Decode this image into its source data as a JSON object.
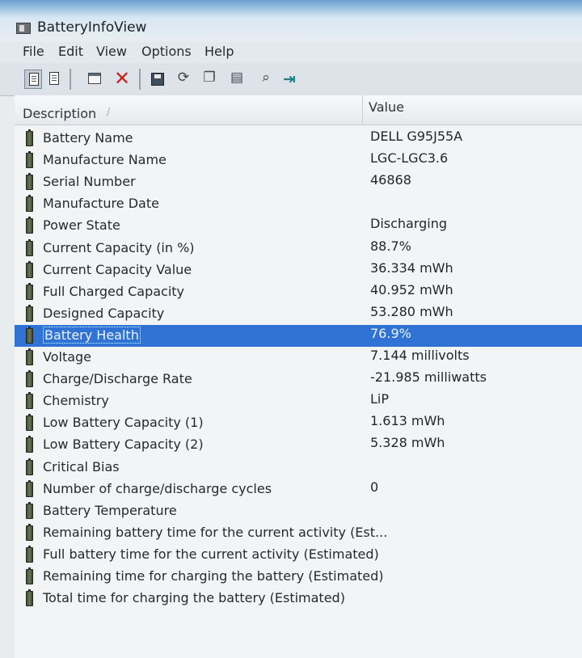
{
  "window": {
    "title": "BatteryInfoView",
    "icon": "battery-app-icon"
  },
  "menu": [
    "File",
    "Edit",
    "View",
    "Options",
    "Help"
  ],
  "toolbar": {
    "buttons": [
      "view-mode-icon",
      "report-icon",
      "open-icon",
      "delete-icon",
      "save-icon",
      "refresh-icon",
      "copy-icon",
      "properties-icon",
      "find-icon",
      "exit-icon"
    ]
  },
  "list": {
    "columns": {
      "description": "Description",
      "value": "Value"
    },
    "rows": [
      {
        "description": "Battery Name",
        "value": "DELL G95J55A"
      },
      {
        "description": "Manufacture Name",
        "value": "LGC-LGC3.6"
      },
      {
        "description": "Serial Number",
        "value": "46868"
      },
      {
        "description": "Manufacture Date",
        "value": ""
      },
      {
        "description": "Power State",
        "value": "Discharging"
      },
      {
        "description": "Current Capacity (in %)",
        "value": "88.7%"
      },
      {
        "description": "Current Capacity Value",
        "value": "36.334 mWh"
      },
      {
        "description": "Full Charged Capacity",
        "value": "40.952 mWh"
      },
      {
        "description": "Designed Capacity",
        "value": "53.280 mWh"
      },
      {
        "description": "Battery Health",
        "value": "76.9%",
        "selected": true
      },
      {
        "description": "Voltage",
        "value": "7.144 millivolts"
      },
      {
        "description": "Charge/Discharge Rate",
        "value": "-21.985 milliwatts"
      },
      {
        "description": "Chemistry",
        "value": "LiP"
      },
      {
        "description": "Low Battery Capacity (1)",
        "value": "1.613 mWh"
      },
      {
        "description": "Low Battery Capacity (2)",
        "value": "5.328 mWh"
      },
      {
        "description": "Critical Bias",
        "value": ""
      },
      {
        "description": "Number of charge/discharge cycles",
        "value": "0"
      },
      {
        "description": "Battery Temperature",
        "value": ""
      },
      {
        "description": "Remaining battery time for the current activity (Est...",
        "value": ""
      },
      {
        "description": "Full battery time for the current activity (Estimated)",
        "value": ""
      },
      {
        "description": "Remaining time for charging the battery (Estimated)",
        "value": ""
      },
      {
        "description": "Total  time for charging the battery (Estimated)",
        "value": ""
      }
    ]
  },
  "colors": {
    "selection": "#3173d4",
    "title_gradient_top": "#6aa0cf"
  }
}
